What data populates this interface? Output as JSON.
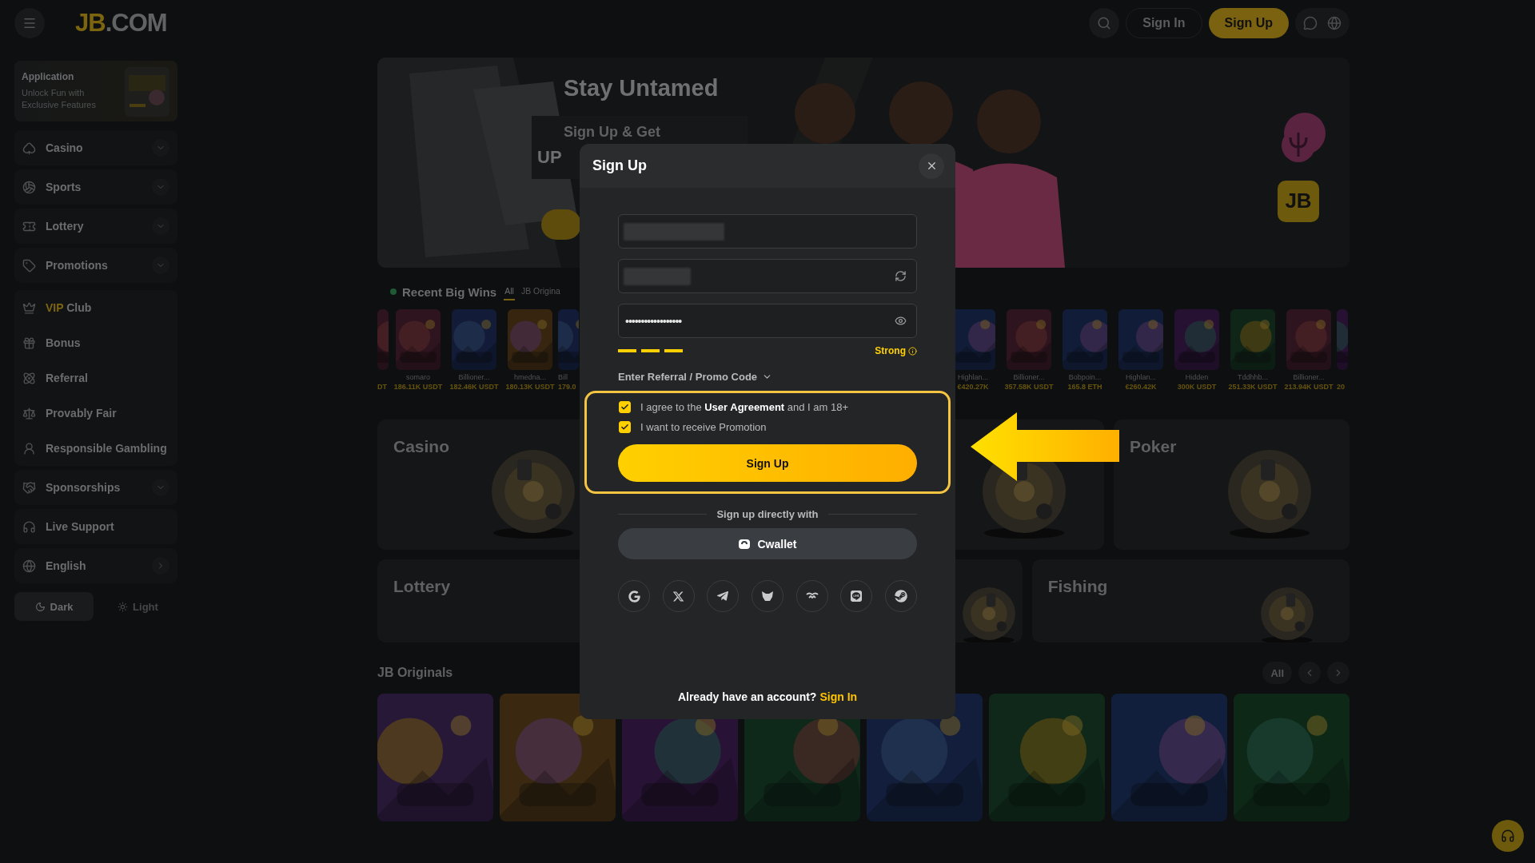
{
  "header": {
    "logo": {
      "accent": "JB",
      "rest": ".COM"
    },
    "sign_in": "Sign In",
    "sign_up": "Sign Up"
  },
  "sidebar": {
    "app_card": {
      "title": "Application",
      "text": "Unlock Fun with Exclusive Features"
    },
    "groups": [
      [
        {
          "label": "Casino",
          "kind": "expand"
        }
      ],
      [
        {
          "label": "Sports",
          "kind": "expand"
        }
      ],
      [
        {
          "label": "Lottery",
          "kind": "expand"
        }
      ],
      [
        {
          "label": "Promotions",
          "kind": "expand"
        }
      ],
      [
        {
          "accent": "VIP",
          "label": "Club",
          "kind": "link"
        },
        {
          "label": "Bonus",
          "kind": "link"
        },
        {
          "label": "Referral",
          "kind": "link"
        },
        {
          "label": "Provably Fair",
          "kind": "link"
        },
        {
          "label": "Responsible Gambling",
          "kind": "link"
        }
      ],
      [
        {
          "label": "Sponsorships",
          "kind": "expand"
        }
      ],
      [
        {
          "label": "Live Support",
          "kind": "link"
        }
      ],
      [
        {
          "label": "English",
          "kind": "arrow"
        }
      ]
    ],
    "theme": [
      {
        "label": "Dark",
        "selected": true
      },
      {
        "label": "Light",
        "selected": false
      }
    ]
  },
  "banner": {
    "title": "Stay Untamed",
    "promo": "Sign Up & Get",
    "promo_cut": "UP",
    "badge": "JB"
  },
  "recent_wins": {
    "title": "Recent Big Wins",
    "tabs": [
      {
        "label": "All",
        "selected": true
      },
      {
        "label": "JB Origina",
        "selected": false
      }
    ],
    "tiles_left": [
      {
        "kind": "partial",
        "amount": "DT"
      },
      {
        "kind": "tile",
        "user": "somaro",
        "amount": "186.11K USDT"
      },
      {
        "kind": "tile",
        "user": "Billioner...",
        "amount": "182.46K USDT"
      },
      {
        "kind": "tile",
        "user": "hmedna...",
        "amount": "180.13K USDT"
      },
      {
        "kind": "cut",
        "user": "Bill",
        "amount": "179.0"
      }
    ],
    "tiles_right": [
      {
        "kind": "tile",
        "user": "Highlan...",
        "amount": "€420.27K"
      },
      {
        "kind": "tile",
        "user": "Billioner...",
        "amount": "357.58K USDT"
      },
      {
        "kind": "tile",
        "user": "Bobpoin...",
        "amount": "165.8 ETH"
      },
      {
        "kind": "tile",
        "user": "Highlan...",
        "amount": "€260.42K"
      },
      {
        "kind": "tile",
        "user": "Hidden",
        "amount": "300K USDT"
      },
      {
        "kind": "tile",
        "user": "Tddhhb...",
        "amount": "251.33K USDT"
      },
      {
        "kind": "tile",
        "user": "Billioner...",
        "amount": "213.94K USDT"
      },
      {
        "kind": "partial",
        "amount": "20"
      }
    ]
  },
  "categories": [
    [
      {
        "kind": "card",
        "title": "Casino"
      },
      {
        "kind": "covered"
      },
      {
        "kind": "art"
      },
      {
        "kind": "card",
        "title": "Poker"
      }
    ],
    [
      {
        "kind": "card",
        "title": "Lottery"
      },
      {
        "kind": "art"
      },
      {
        "kind": "card",
        "title": "Fishing"
      }
    ]
  ],
  "originals": {
    "title": "JB Originals",
    "all": "All"
  },
  "modal": {
    "title": "Sign Up",
    "fields": [
      {
        "kind": "blurred"
      },
      {
        "kind": "refresh"
      },
      {
        "kind": "password",
        "value": "••••••••••••••••••"
      }
    ],
    "strength": {
      "level": 1,
      "label": "Strong"
    },
    "referral": "Enter Referral / Promo Code",
    "checks": [
      {
        "text": "I agree to the **User Agreement** and I am 18+",
        "checked": true
      },
      {
        "text": "I want to receive Promotion",
        "checked": true
      }
    ],
    "submit": "Sign Up",
    "divider": "Sign up directly with",
    "wallet": "Cwallet",
    "socials": [
      {
        "kind": "google"
      },
      {
        "kind": "x"
      },
      {
        "kind": "telegram"
      },
      {
        "kind": "fox"
      },
      {
        "kind": "wave"
      },
      {
        "kind": "line"
      },
      {
        "kind": "steam"
      }
    ],
    "footer": {
      "text": "Already have an account?",
      "link": "Sign In"
    }
  }
}
